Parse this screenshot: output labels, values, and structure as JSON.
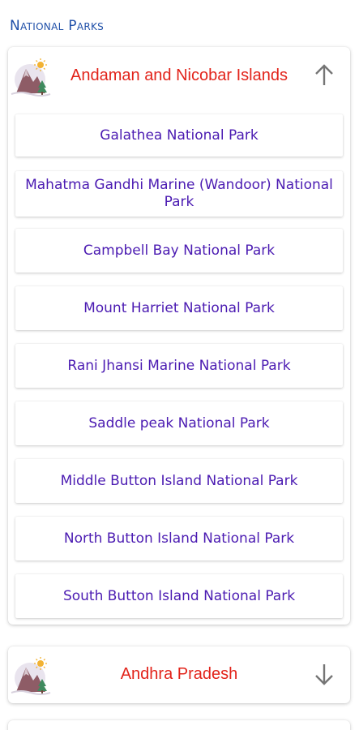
{
  "section_title": "National Parks",
  "colors": {
    "section_title": "#1f4fa8",
    "state_name": "#e2231a",
    "park_name": "#4b1bb2",
    "arrow": "#757575"
  },
  "states": [
    {
      "name": "Andaman and Nicobar Islands",
      "icon": "mountain-sun-icon",
      "arrow_icon": "arrow-up-icon",
      "expanded": true,
      "parks": [
        "Galathea National Park",
        "Mahatma Gandhi Marine (Wandoor) National Park",
        "Campbell Bay National Park",
        "Mount Harriet National Park",
        "Rani Jhansi Marine National Park",
        "Saddle peak National Park",
        "Middle Button Island National Park",
        "North Button Island National Park",
        "South Button Island National Park"
      ]
    },
    {
      "name": "Andhra Pradesh",
      "icon": "mountain-sun-icon",
      "arrow_icon": "arrow-down-icon",
      "expanded": false
    }
  ]
}
